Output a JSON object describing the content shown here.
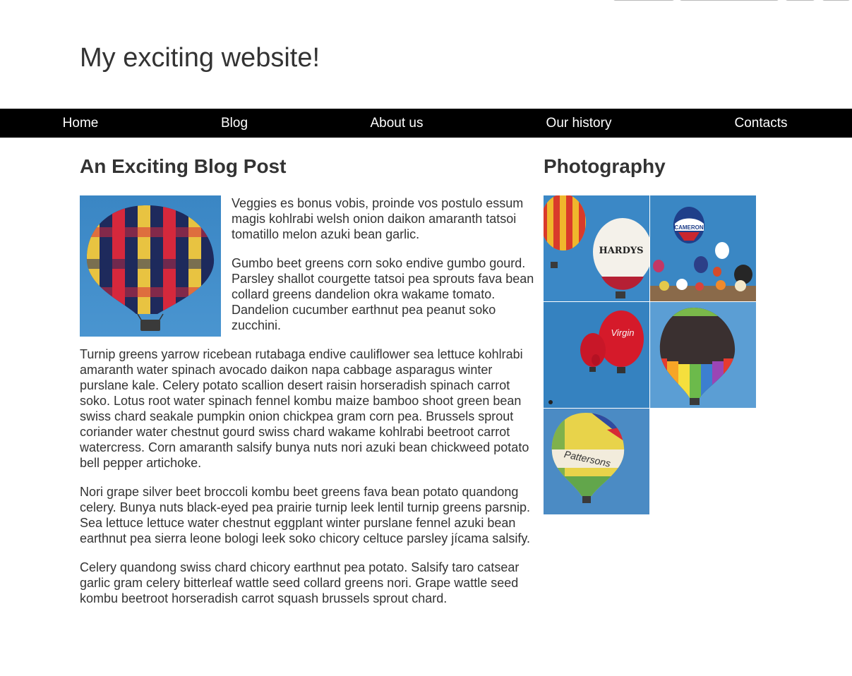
{
  "site": {
    "title": "My exciting website!"
  },
  "nav": {
    "items": [
      {
        "label": "Home"
      },
      {
        "label": "Blog"
      },
      {
        "label": "About us"
      },
      {
        "label": "Our history"
      },
      {
        "label": "Contacts"
      }
    ]
  },
  "post": {
    "heading": "An Exciting Blog Post",
    "paragraphs": [
      "Veggies es bonus vobis, proinde vos postulo essum magis kohlrabi welsh onion daikon amaranth tatsoi tomatillo melon azuki bean garlic.",
      "Gumbo beet greens corn soko endive gumbo gourd. Parsley shallot courgette tatsoi pea sprouts fava bean collard greens dandelion okra wakame tomato. Dandelion cucumber earthnut pea peanut soko zucchini.",
      "Turnip greens yarrow ricebean rutabaga endive cauliflower sea lettuce kohlrabi amaranth water spinach avocado daikon napa cabbage asparagus winter purslane kale. Celery potato scallion desert raisin horseradish spinach carrot soko. Lotus root water spinach fennel kombu maize bamboo shoot green bean swiss chard seakale pumpkin onion chickpea gram corn pea. Brussels sprout coriander water chestnut gourd swiss chard wakame kohlrabi beetroot carrot watercress. Corn amaranth salsify bunya nuts nori azuki bean chickweed potato bell pepper artichoke.",
      "Nori grape silver beet broccoli kombu beet greens fava bean potato quandong celery. Bunya nuts black-eyed pea prairie turnip leek lentil turnip greens parsnip. Sea lettuce lettuce water chestnut eggplant winter purslane fennel azuki bean earthnut pea sierra leone bologi leek soko chicory celtuce parsley jícama salsify.",
      "Celery quandong swiss chard chicory earthnut pea potato. Salsify taro catsear garlic gram celery bitterleaf wattle seed collard greens nori. Grape wattle seed kombu beetroot horseradish carrot squash brussels sprout chard."
    ]
  },
  "gallery": {
    "heading": "Photography",
    "balloon_labels": {
      "hardys": "HARDYS",
      "cameron": "CAMERON",
      "virgin": "Virgin",
      "pattersons": "Pattersons"
    }
  },
  "colors": {
    "sky": "#3d8cc8",
    "navbar": "#000000",
    "text": "#333333"
  }
}
